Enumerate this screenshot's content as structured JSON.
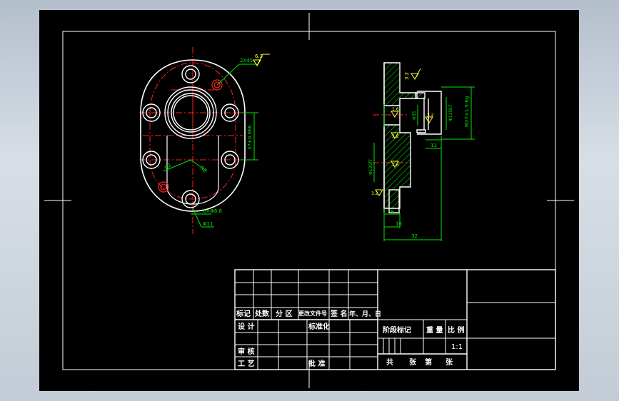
{
  "drawing": {
    "colors": {
      "background": "#000000",
      "border": "#ffffff",
      "object": "#ffffff",
      "centerline": "#ff2020",
      "dimension": "#00e600",
      "roughness": "#ffff33",
      "hatch": "#00e600"
    }
  },
  "left_view": {
    "chamfer_label": "2X45",
    "roughness_top": "6.3",
    "dim_vertical": "37±0.066",
    "dim_r": "R2",
    "dim_r2": "R2",
    "hole_label_1": "6×Φ8.8",
    "hole_label_2": "Φ11"
  },
  "section_view": {
    "roughness_top": "3.2",
    "dim_thread": "M27×1.5-6g",
    "dim_bore": "Φ35",
    "dim_flange_d": "Φ135h7",
    "dim_seal": "Φ135f7",
    "dim_len_11": "11",
    "dim_len_9": "9",
    "dim_len_16": "16",
    "dim_len_32": "32",
    "rough_a": "1.6",
    "rough_b": "3.2",
    "rough_c": "1.6",
    "rough_d": "3.2",
    "rough_e": "3.2"
  },
  "title_block": {
    "h_mark": "标记",
    "h_count": "处数",
    "h_zone": "分 区",
    "h_docno": "更改文件号",
    "h_sign": "签 名",
    "h_date": "年、月、日",
    "design": "设 计",
    "standard": "标准化",
    "stage_mark": "阶段标记",
    "weight": "重 量",
    "scale": "比 例",
    "scale_value": "1:1",
    "review": "审 核",
    "process": "工 艺",
    "approve": "批 准",
    "total": "共",
    "sheets_1": "张",
    "page": "第",
    "sheets_2": "张"
  }
}
